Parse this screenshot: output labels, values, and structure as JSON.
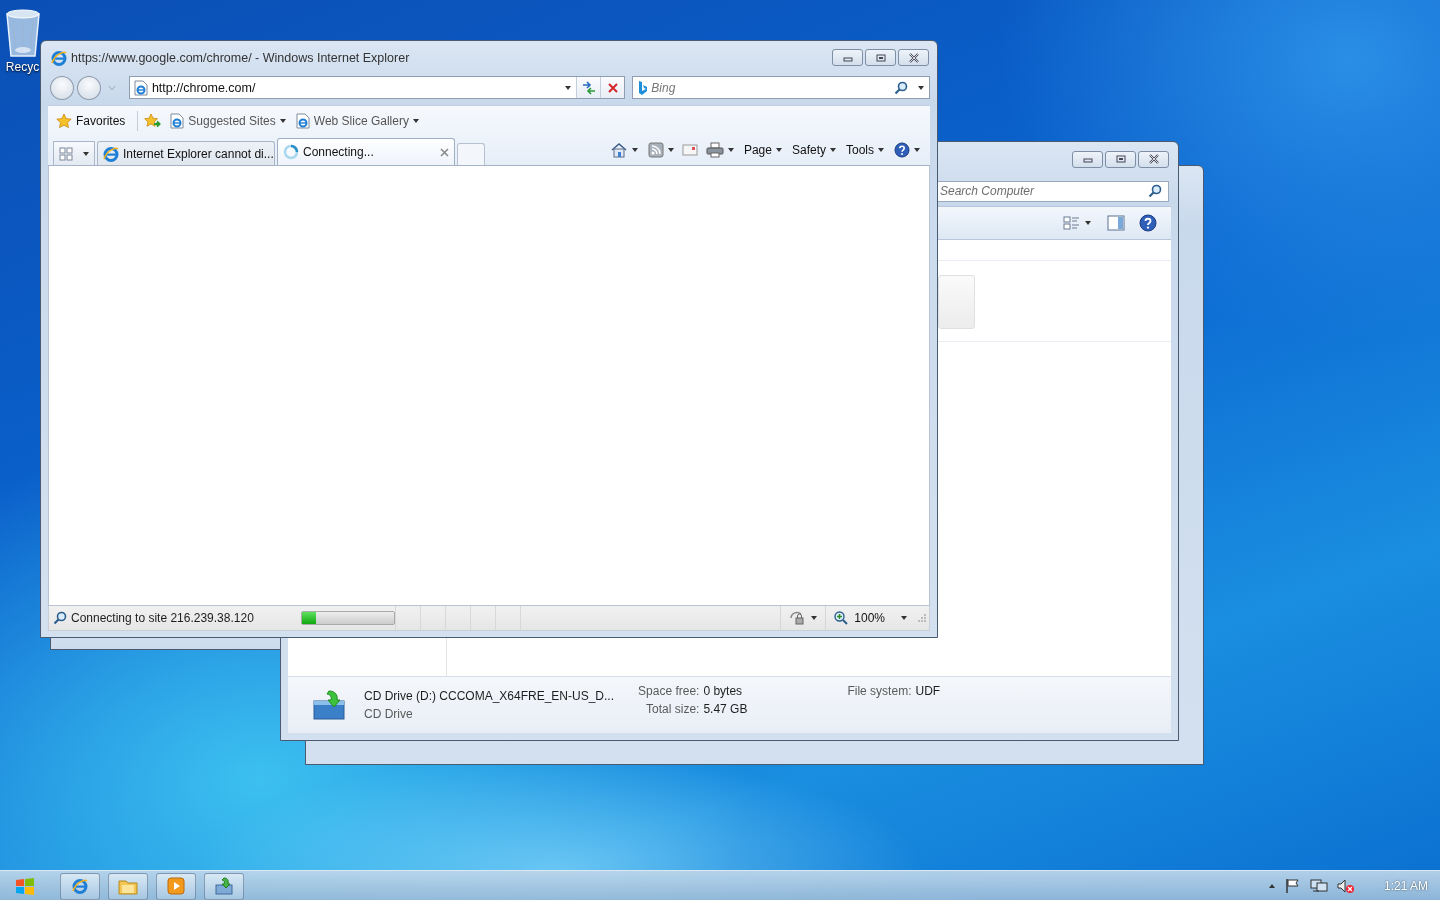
{
  "desktop": {
    "icons": [
      {
        "label": "Recyc"
      }
    ]
  },
  "explorer": {
    "search": {
      "placeholder": "Search Computer"
    },
    "details": {
      "name": "CD Drive (D:) CCCOMA_X64FRE_EN-US_D...",
      "type": "CD Drive",
      "fields": [
        {
          "label": "Space free:",
          "value": "0 bytes"
        },
        {
          "label": "Total size:",
          "value": "5.47 GB"
        },
        {
          "label": "File system:",
          "value": "UDF"
        }
      ]
    }
  },
  "browser": {
    "title": "https://www.google.com/chrome/ - Windows Internet Explorer",
    "address": "http://chrome.com/",
    "search": {
      "placeholder": "Bing"
    },
    "favorites_bar": [
      {
        "kind": "favorites",
        "label": "Favorites"
      },
      {
        "kind": "link",
        "label": "Suggested Sites"
      },
      {
        "kind": "link",
        "label": "Web Slice Gallery"
      }
    ],
    "tabs": [
      {
        "label": "Internet Explorer cannot di...",
        "selected": false,
        "loading": false
      },
      {
        "label": "Connecting...",
        "selected": true,
        "loading": true
      }
    ],
    "commands": [
      "Page",
      "Safety",
      "Tools"
    ],
    "status": {
      "text": "Connecting to site 216.239.38.120",
      "level": 0.15,
      "zoom": "100%"
    }
  },
  "taskbar": {
    "items": [
      {
        "kind": "browser"
      },
      {
        "kind": "folder"
      },
      {
        "kind": "media"
      },
      {
        "kind": "setup"
      }
    ],
    "clock": "1:21 AM"
  }
}
